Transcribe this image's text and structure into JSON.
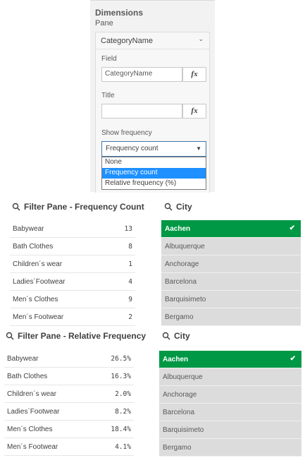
{
  "properties": {
    "heading": "Dimensions",
    "subheading": "Pane",
    "dimension_card": {
      "title": "CategoryName",
      "field_label": "Field",
      "field_value": "CategoryName",
      "title_label": "Title",
      "title_value": "",
      "fx_label": "fx",
      "show_frequency_label": "Show frequency",
      "show_frequency_value": "Frequency count",
      "options": [
        "None",
        "Frequency count",
        "Relative frequency (%)"
      ]
    }
  },
  "filter_count": {
    "title": "Filter Pane - Frequency Count",
    "rows": [
      {
        "name": "Babywear",
        "value": "13"
      },
      {
        "name": "Bath Clothes",
        "value": "8"
      },
      {
        "name": "Children´s wear",
        "value": "1"
      },
      {
        "name": "Ladies´Footwear",
        "value": "4"
      },
      {
        "name": "Men´s Clothes",
        "value": "9"
      },
      {
        "name": "Men´s Footwear",
        "value": "2"
      }
    ]
  },
  "city_1": {
    "title": "City",
    "items": [
      "Aachen",
      "Albuquerque",
      "Anchorage",
      "Barcelona",
      "Barquisimeto",
      "Bergamo"
    ],
    "selected": "Aachen"
  },
  "filter_relative": {
    "title": "Filter Pane - Relative Frequency",
    "rows": [
      {
        "name": "Babywear",
        "value": "26.5%"
      },
      {
        "name": "Bath Clothes",
        "value": "16.3%"
      },
      {
        "name": "Children´s wear",
        "value": "2.0%"
      },
      {
        "name": "Ladies´Footwear",
        "value": "8.2%"
      },
      {
        "name": "Men´s Clothes",
        "value": "18.4%"
      },
      {
        "name": "Men´s Footwear",
        "value": "4.1%"
      }
    ]
  },
  "city_2": {
    "title": "City",
    "items": [
      "Aachen",
      "Albuquerque",
      "Anchorage",
      "Barcelona",
      "Barquisimeto",
      "Bergamo"
    ],
    "selected": "Aachen"
  },
  "colors": {
    "selected_green": "#009845",
    "dropdown_highlight": "#1e90ff",
    "city_item_gray": "#dcdcdc"
  },
  "icons": {
    "search": "search-icon",
    "chevron": "chevron-down-icon",
    "check": "check-icon"
  }
}
